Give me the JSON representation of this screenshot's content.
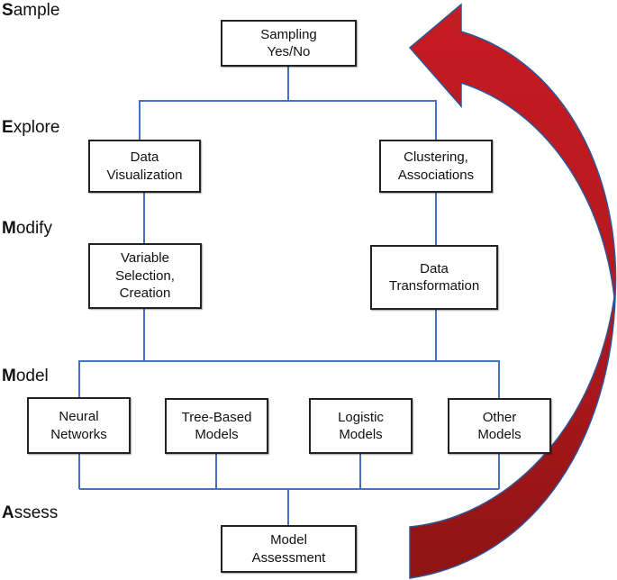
{
  "diagram": {
    "type": "SEMMA process flowchart",
    "phases": [
      {
        "initial": "S",
        "rest": "ample"
      },
      {
        "initial": "E",
        "rest": "xplore"
      },
      {
        "initial": "M",
        "rest": "odify"
      },
      {
        "initial": "M",
        "rest": "odel"
      },
      {
        "initial": "A",
        "rest": "ssess"
      }
    ],
    "nodes": {
      "sampling": "Sampling\nYes/No",
      "data_visualization": "Data\nVisualization",
      "clustering": "Clustering,\nAssociations",
      "variable_selection": "Variable\nSelection,\nCreation",
      "data_transformation": "Data\nTransformation",
      "neural_networks": "Neural\nNetworks",
      "tree_based": "Tree-Based\nModels",
      "logistic": "Logistic\nModels",
      "other": "Other\nModels",
      "model_assessment": "Model\nAssessment"
    },
    "edges": [
      [
        "sampling",
        "data_visualization"
      ],
      [
        "sampling",
        "clustering"
      ],
      [
        "data_visualization",
        "variable_selection"
      ],
      [
        "clustering",
        "data_transformation"
      ],
      [
        "variable_selection",
        "neural_networks"
      ],
      [
        "variable_selection",
        "tree_based"
      ],
      [
        "variable_selection",
        "logistic"
      ],
      [
        "variable_selection",
        "other"
      ],
      [
        "data_transformation",
        "neural_networks"
      ],
      [
        "data_transformation",
        "other"
      ],
      [
        "neural_networks",
        "model_assessment"
      ],
      [
        "tree_based",
        "model_assessment"
      ],
      [
        "logistic",
        "model_assessment"
      ],
      [
        "other",
        "model_assessment"
      ]
    ],
    "feedback_arrow": {
      "from": "model_assessment",
      "to": "sampling",
      "meaning": "iterate"
    },
    "colors": {
      "connector": "#4472C4",
      "box_border": "#222222",
      "arrow_top": "#C01A22",
      "arrow_bottom": "#8E1414",
      "arrow_outline": "#2F5597"
    }
  }
}
